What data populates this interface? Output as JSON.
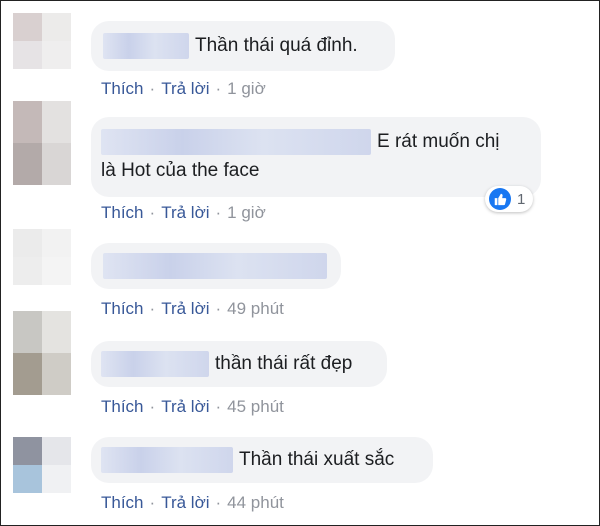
{
  "actions": {
    "like": "Thích",
    "reply": "Trả lời",
    "separator": "·"
  },
  "comments": [
    {
      "text": "Thần thái quá đỉnh.",
      "time": "1 giờ"
    },
    {
      "text_line1": "E rát muốn chị",
      "text_line2": "là Hot của the face",
      "time": "1 giờ",
      "reaction_icon": "like-icon",
      "reaction_count": "1"
    },
    {
      "text": "",
      "time": "49 phút"
    },
    {
      "text": "thần thái rất đẹp",
      "time": "45 phút"
    },
    {
      "text": "Thần thái xuất sắc",
      "time": "44 phút"
    }
  ],
  "colors": {
    "link": "#385898",
    "meta": "#90949c",
    "bubble": "#f2f3f5",
    "like_blue": "#1877f2"
  }
}
